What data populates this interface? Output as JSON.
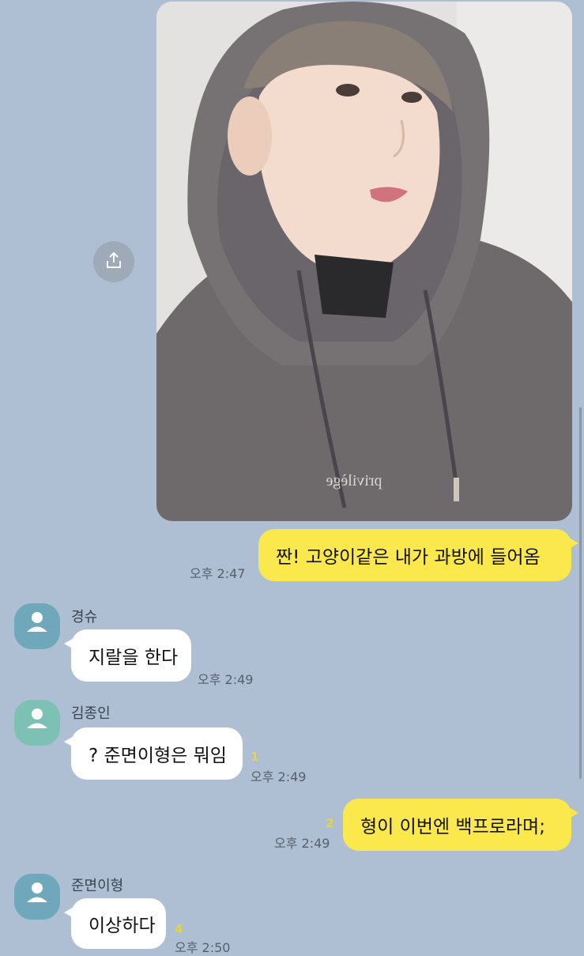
{
  "chat": {
    "messages": [
      {
        "sender": "me",
        "time": "오후 2:47",
        "text": "짠! 고양이같은 내가 과방에 들어옴"
      },
      {
        "sender": "경슈",
        "time": "오후 2:49",
        "text": "지랄을 한다"
      },
      {
        "sender": "김종인",
        "time": "오후 2:49",
        "text": "? 준면이형은 뭐임",
        "unread": "1"
      },
      {
        "sender": "me",
        "time": "오후 2:49",
        "text": "형이 이번엔 백프로라며;",
        "unread": "2"
      },
      {
        "sender": "준면이형",
        "time": "오후 2:50",
        "text": "이상하다",
        "unread": "4"
      }
    ]
  },
  "photo": {
    "hoodie_print": "privilège"
  },
  "colors": {
    "chat_background": "#aebfd3",
    "my_bubble": "#fae84c",
    "other_bubble": "#ffffff",
    "unread_count": "#e8d53a",
    "avatar_blue": "#6fa7bb",
    "avatar_teal": "#7cc1b3"
  },
  "icons": {
    "share": "share-icon",
    "avatar": "default-profile-icon"
  }
}
